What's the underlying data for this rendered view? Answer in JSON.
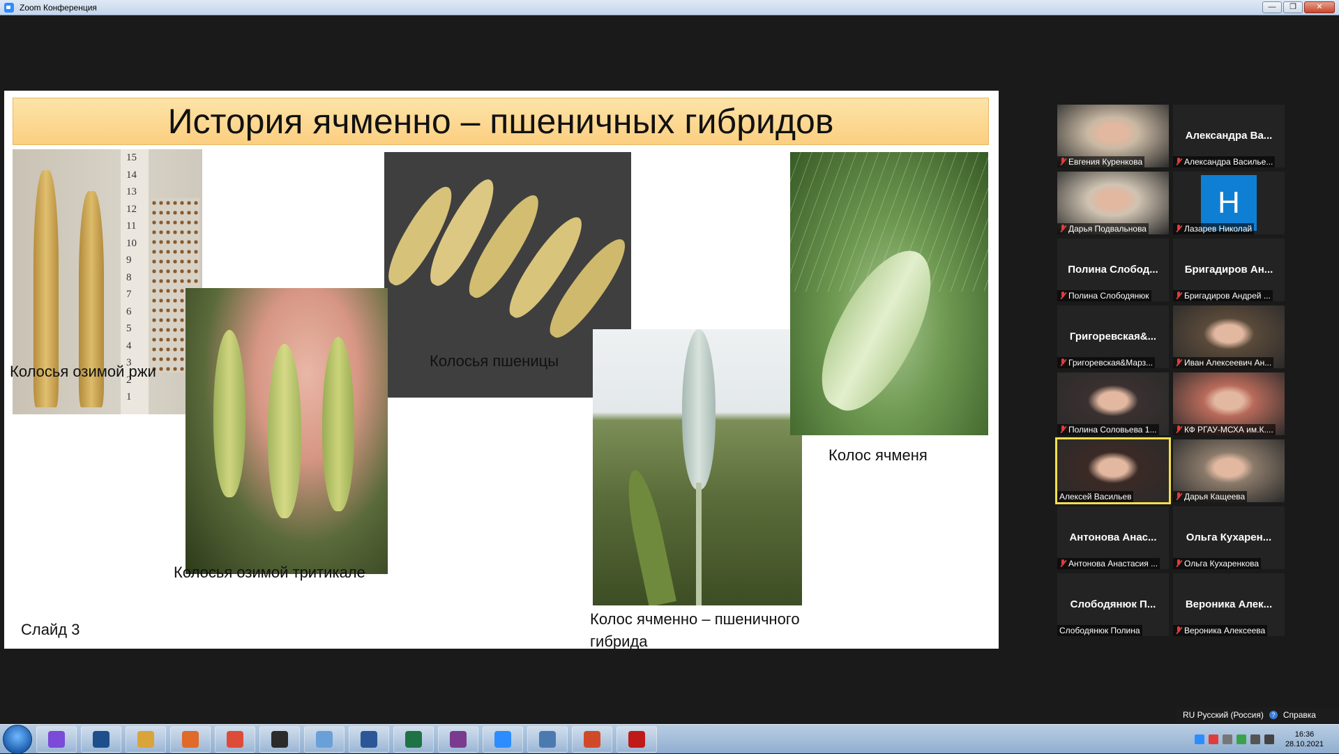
{
  "window": {
    "title": "Zoom Конференция",
    "minimize": "—",
    "maximize": "❐",
    "close": "✕"
  },
  "slide": {
    "title": "История ячменно – пшеничных гибридов",
    "captions": {
      "rye": "Колосья озимой ржи",
      "triticale": "Колосья озимой тритикале",
      "wheat": "Колосья пшеницы",
      "hybrid": "Колос ячменно – пшеничного гибрида",
      "barley": "Колос ячменя",
      "slide_number": "Слайд 3"
    },
    "ruler_marks": [
      "15",
      "14",
      "13",
      "12",
      "11",
      "10",
      "9",
      "8",
      "7",
      "6",
      "5",
      "4",
      "3",
      "2",
      "1"
    ]
  },
  "participants": [
    {
      "display": "",
      "label": "Евгения Куренкова",
      "muted": true,
      "video": true,
      "active": false
    },
    {
      "display": "Александра Ва...",
      "label": "Александра Василье...",
      "muted": true,
      "video": false,
      "active": false
    },
    {
      "display": "",
      "label": "Дарья Подвальнова",
      "muted": true,
      "video": true,
      "active": false
    },
    {
      "display": "H",
      "label": "Лазарев Николай",
      "muted": true,
      "video": false,
      "active": false,
      "avatar": true
    },
    {
      "display": "Полина Слобод...",
      "label": "Полина Слободянюк",
      "muted": true,
      "video": false,
      "active": false
    },
    {
      "display": "Бригадиров Ан...",
      "label": "Бригадиров Андрей ...",
      "muted": true,
      "video": false,
      "active": false
    },
    {
      "display": "Григоревская&...",
      "label": "Григоревская&Марз...",
      "muted": true,
      "video": false,
      "active": false
    },
    {
      "display": "",
      "label": "Иван Алексеевич Ан...",
      "muted": true,
      "video": true,
      "active": false
    },
    {
      "display": "",
      "label": "Полина Соловьева 1...",
      "muted": true,
      "video": true,
      "active": false
    },
    {
      "display": "",
      "label": "КФ РГАУ-МСХА им.К....",
      "muted": true,
      "video": true,
      "active": false
    },
    {
      "display": "",
      "label": "Алексей Васильев",
      "muted": false,
      "video": true,
      "active": true
    },
    {
      "display": "",
      "label": "Дарья Кащеева",
      "muted": true,
      "video": true,
      "active": false
    },
    {
      "display": "Антонова Анас...",
      "label": "Антонова Анастасия ...",
      "muted": true,
      "video": false,
      "active": false
    },
    {
      "display": "Ольга Кухарен...",
      "label": "Ольга Кухаренкова",
      "muted": true,
      "video": false,
      "active": false
    },
    {
      "display": "Слободянюк П...",
      "label": "Слободянюк Полина",
      "muted": false,
      "video": false,
      "active": false
    },
    {
      "display": "Вероника Алек...",
      "label": "Вероника Алексеева",
      "muted": true,
      "video": false,
      "active": false
    }
  ],
  "langbar": {
    "language": "RU Русский (Россия)",
    "help": "Справка"
  },
  "taskbar": {
    "apps": [
      "alice-icon",
      "explorer-icon",
      "file-manager-icon",
      "media-player-icon",
      "chrome-icon",
      "calculator-icon",
      "paint-icon",
      "word-icon",
      "excel-icon",
      "winrar-icon",
      "zoom-icon",
      "photo-viewer-icon",
      "powerpoint-icon",
      "acrobat-icon"
    ],
    "time": "16:36",
    "date": "28.10.2021"
  }
}
